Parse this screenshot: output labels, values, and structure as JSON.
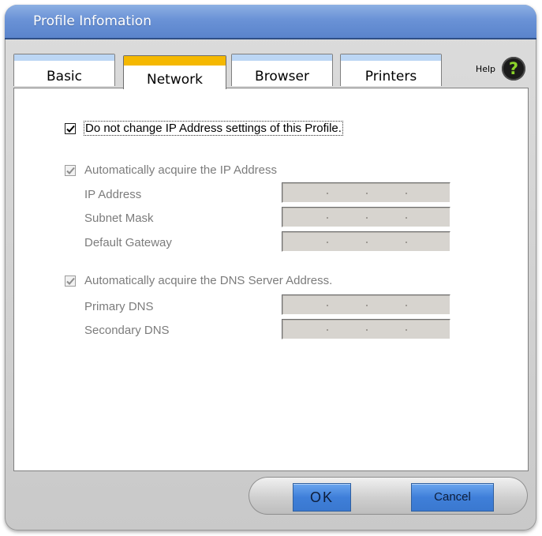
{
  "window": {
    "title": "Profile Infomation"
  },
  "tabs": [
    {
      "label": "Basic",
      "active": false
    },
    {
      "label": "Network",
      "active": true
    },
    {
      "label": "Browser",
      "active": false
    },
    {
      "label": "Printers",
      "active": false
    }
  ],
  "help": {
    "label": "Help",
    "icon": "question-mark-icon"
  },
  "network": {
    "keep_settings": {
      "label": "Do not change IP Address settings of this Profile.",
      "checked": true,
      "enabled": true
    },
    "auto_ip": {
      "label": "Automatically acquire the IP Address",
      "checked": true,
      "enabled": false
    },
    "ip_fields": [
      {
        "label": "IP Address",
        "value": ""
      },
      {
        "label": "Subnet Mask",
        "value": ""
      },
      {
        "label": "Default Gateway",
        "value": ""
      }
    ],
    "auto_dns": {
      "label": "Automatically acquire the DNS Server Address.",
      "checked": true,
      "enabled": false
    },
    "dns_fields": [
      {
        "label": "Primary DNS",
        "value": ""
      },
      {
        "label": "Secondary DNS",
        "value": ""
      }
    ]
  },
  "buttons": {
    "ok_label": "OK",
    "cancel_label": "Cancel"
  },
  "colors": {
    "title_bar": "#6a92d6",
    "active_tab_accent": "#f5b800",
    "inactive_tab_accent": "#bcd6f4",
    "button_blue": "#3f7fd9",
    "help_icon_green": "#8bd32a"
  }
}
